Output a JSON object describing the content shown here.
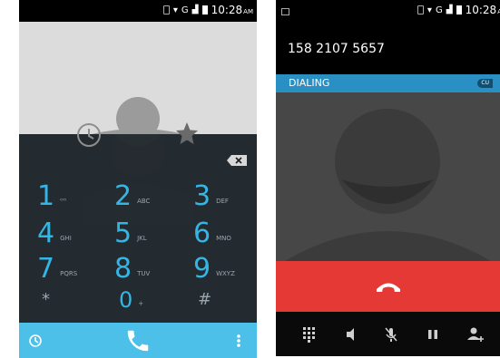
{
  "left_screen": {
    "status": {
      "time": "10:28",
      "ampm": "AM"
    },
    "keys": [
      {
        "digit": "1",
        "letters": "ᴼᴼ"
      },
      {
        "digit": "2",
        "letters": "ABC"
      },
      {
        "digit": "3",
        "letters": "DEF"
      },
      {
        "digit": "4",
        "letters": "GHI"
      },
      {
        "digit": "5",
        "letters": "JKL"
      },
      {
        "digit": "6",
        "letters": "MNO"
      },
      {
        "digit": "7",
        "letters": "PQRS"
      },
      {
        "digit": "8",
        "letters": "TUV"
      },
      {
        "digit": "9",
        "letters": "WXYZ"
      },
      {
        "digit": "*",
        "letters": ""
      },
      {
        "digit": "0",
        "letters": "+"
      },
      {
        "digit": "#",
        "letters": ""
      }
    ],
    "icons": {
      "backspace": "backspace-icon",
      "recent": "clock-icon",
      "call": "phone-icon",
      "menu": "overflow-menu-icon",
      "favorite": "star-icon"
    },
    "colors": {
      "accent": "#34b6e5",
      "bottom_bar": "#4cc0e8"
    }
  },
  "right_screen": {
    "status": {
      "time": "10:28",
      "ampm": "A"
    },
    "phone_number": "158 2107 5657",
    "call_state": "DIALING",
    "sim_label": "CU",
    "colors": {
      "dial_bar": "#2a8fc3",
      "end_call": "#e53935"
    }
  }
}
